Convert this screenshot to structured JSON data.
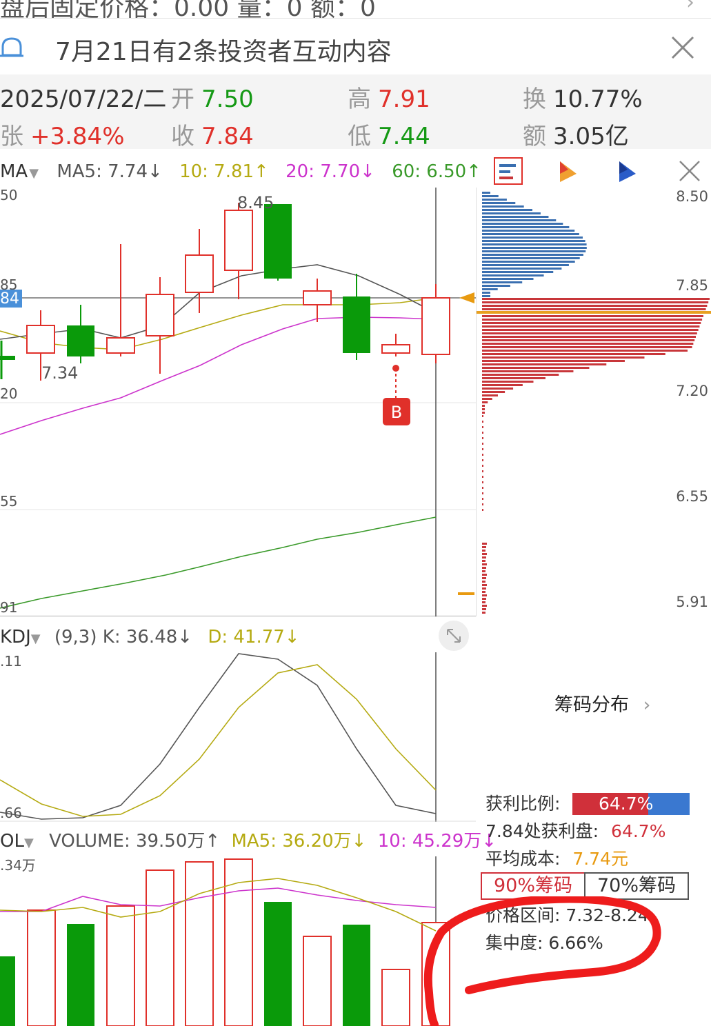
{
  "top_strip": {
    "text": "盘后固定价格：0.00  量：0  额：0"
  },
  "notice": {
    "text": "7月21日有2条投资者互动内容"
  },
  "quote": {
    "date": "2025/07/22/二",
    "open_label": "开",
    "open": "7.50",
    "high_label": "高",
    "high": "7.91",
    "turnover_label": "换",
    "turnover": "10.77%",
    "change_label": "张",
    "change": "+3.84%",
    "close_label": "收",
    "close": "7.84",
    "low_label": "低",
    "low": "7.44",
    "amount_label": "额",
    "amount": "3.05亿"
  },
  "ma_bar": {
    "indicator": "MA",
    "ma5": "MA5: 7.74↓",
    "ma10": "10: 7.81↑",
    "ma20": "20: 7.70↓",
    "ma60": "60: 6.50↑"
  },
  "main_chart": {
    "y_labels": [
      "50",
      "85",
      "84",
      "20",
      "55",
      "91"
    ],
    "annotations": {
      "high": "8.45",
      "low": "7.34",
      "signal": "B"
    }
  },
  "chip_panel": {
    "y_labels": [
      "8.50",
      "7.85",
      "7.20",
      "6.55",
      "5.91"
    ],
    "title": "筹码分布",
    "profit_ratio_label": "获利比例:",
    "profit_ratio": "64.7%",
    "profit_at_label": "7.84处获利盘:",
    "profit_at": "64.7%",
    "avg_cost_label": "平均成本:",
    "avg_cost": "7.74元",
    "tab_90": "90%筹码",
    "tab_70": "70%筹码",
    "range_label": "价格区间:",
    "range": "7.32-8.24",
    "concentration_label": "集中度:",
    "concentration": "6.66%"
  },
  "kdj": {
    "indicator": "KDJ",
    "params": "(9,3)",
    "k": "K: 36.48↓",
    "d": "D: 41.77↓",
    "y_top": ".11",
    "y_bottom": ".66"
  },
  "volume": {
    "indicator": "OL",
    "vol": "VOLUME: 39.50万↑",
    "ma5": "MA5: 36.20万↓",
    "ma10": "10: 45.29万↓",
    "y_top": ".34万"
  },
  "colors": {
    "up": "#e0302a",
    "down": "#0a9a0a",
    "ma5": "#555555",
    "ma10": "#b5aa12",
    "ma20": "#cc33cc",
    "ma60": "#3a9a2a",
    "chip_blue": "#3a6fb0",
    "chip_red": "#c8363a"
  }
}
